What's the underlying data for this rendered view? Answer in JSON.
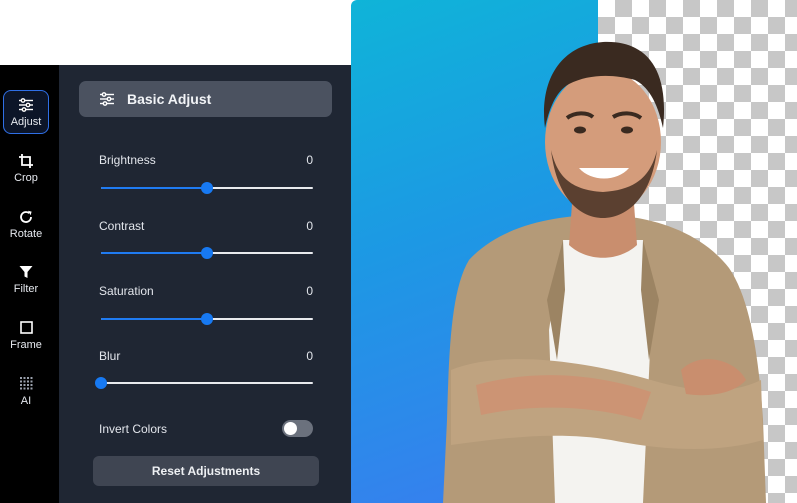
{
  "rail": {
    "tools": [
      {
        "label": "Adjust",
        "icon": "sliders-icon",
        "active": true
      },
      {
        "label": "Crop",
        "icon": "crop-icon"
      },
      {
        "label": "Rotate",
        "icon": "rotate-icon"
      },
      {
        "label": "Filter",
        "icon": "filter-icon"
      },
      {
        "label": "Frame",
        "icon": "frame-icon"
      },
      {
        "label": "AI",
        "icon": "ai-grid-icon"
      }
    ]
  },
  "panel": {
    "title": "Basic Adjust",
    "controls": [
      {
        "label": "Brightness",
        "value": "0",
        "level": 0.5
      },
      {
        "label": "Contrast",
        "value": "0",
        "level": 0.5
      },
      {
        "label": "Saturation",
        "value": "0",
        "level": 0.5
      },
      {
        "label": "Blur",
        "value": "0",
        "level": 0.0
      }
    ],
    "invert_label": "Invert Colors",
    "invert_on": false,
    "reset_label": "Reset Adjustments"
  },
  "colors": {
    "accent": "#1779f2",
    "panel_bg": "#1f2633",
    "rail_bg": "#000000",
    "gradient_start": "#0fb4d8",
    "gradient_end": "#3a7cf0"
  }
}
